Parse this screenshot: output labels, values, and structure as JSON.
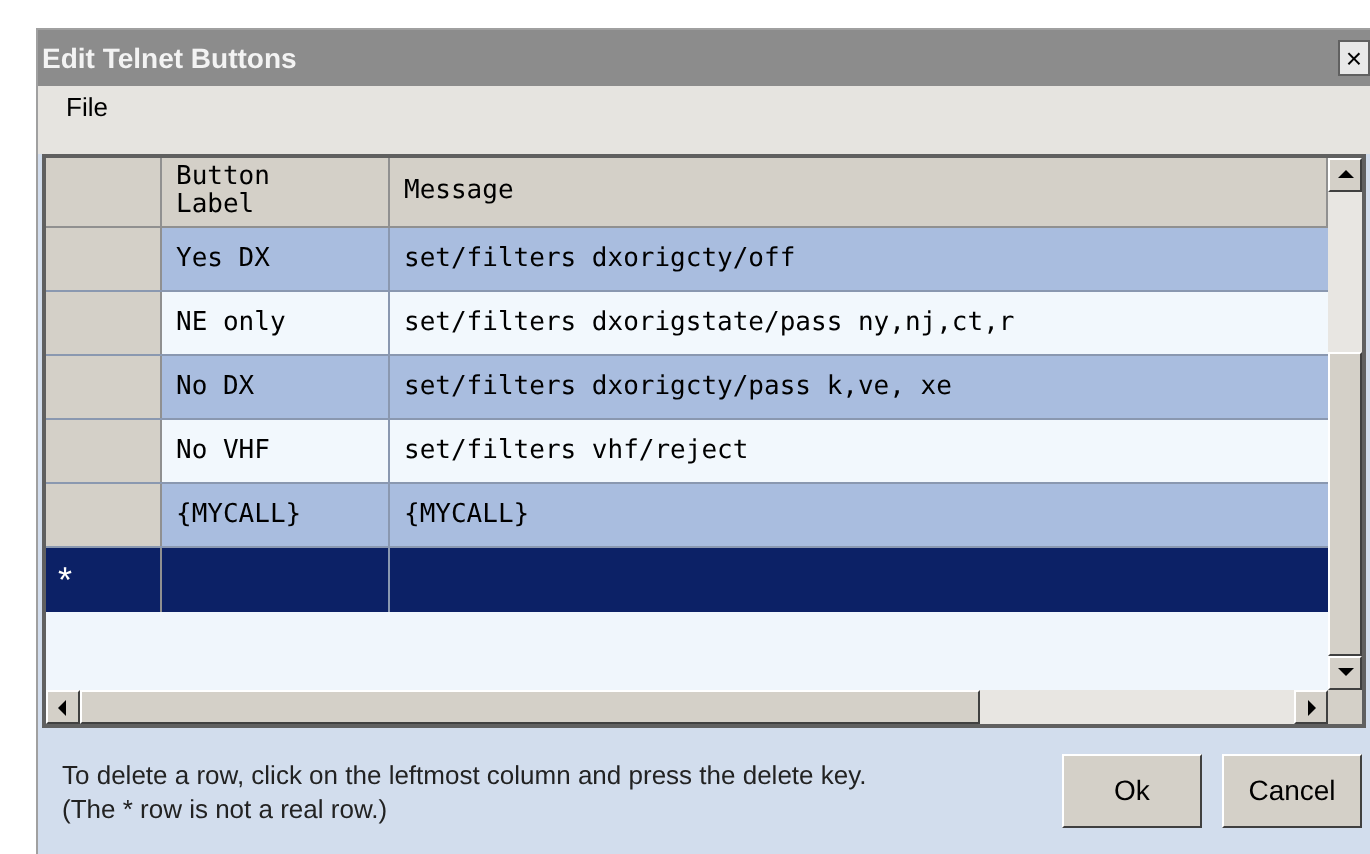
{
  "window": {
    "title": "Edit Telnet Buttons",
    "close": "×"
  },
  "menu": [
    {
      "label": "File"
    }
  ],
  "table": {
    "columns": [
      "Button Label",
      "Message"
    ],
    "rows": [
      {
        "label": "Yes DX",
        "message": "set/filters dxorigcty/off",
        "selected": false
      },
      {
        "label": "NE only",
        "message": "set/filters dxorigstate/pass ny,nj,ct,r",
        "selected": false
      },
      {
        "label": "No DX",
        "message": "set/filters dxorigcty/pass k,ve, xe",
        "selected": false
      },
      {
        "label": "No VHF",
        "message": "set/filters vhf/reject",
        "selected": false
      },
      {
        "label": "{MYCALL}",
        "message": "{MYCALL}",
        "selected": false
      }
    ],
    "new_row": {
      "marker": "*",
      "selected": true
    }
  },
  "hint": [
    "To delete a row, click on the leftmost column and press the delete key.",
    "(The * row is not a real row.)"
  ],
  "buttons": [
    "Ok",
    "Cancel"
  ]
}
